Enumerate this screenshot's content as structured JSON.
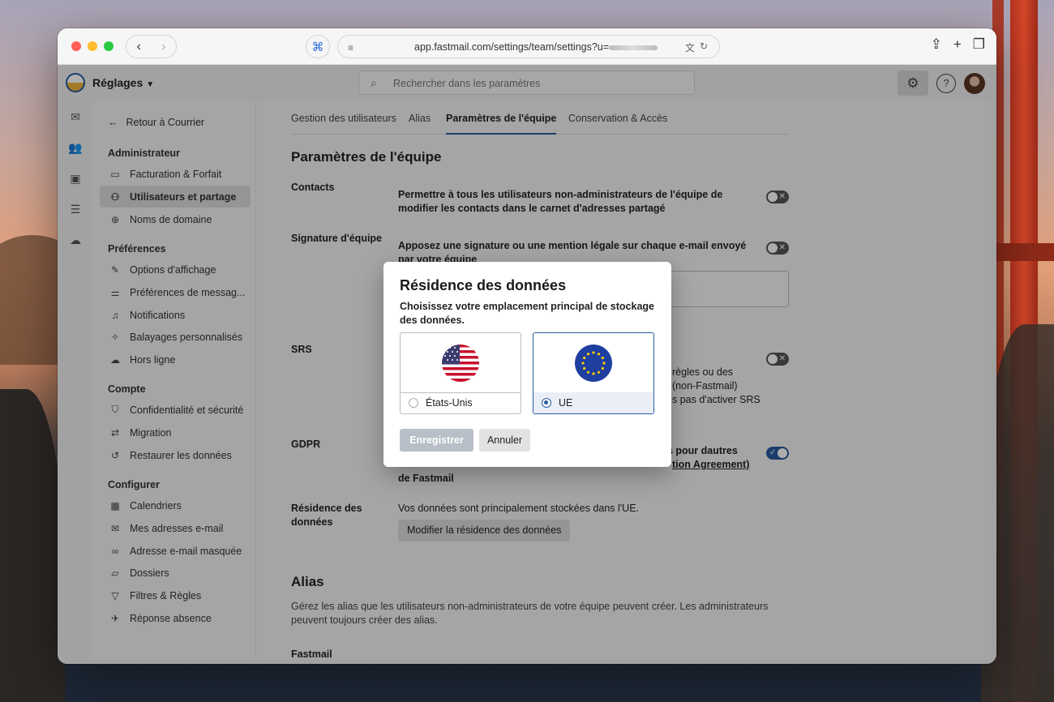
{
  "browser": {
    "url": "app.fastmail.com/settings/team/settings?u=",
    "nav_back": "‹",
    "nav_forward": "›"
  },
  "app": {
    "title": "Réglages",
    "search_placeholder": "Rechercher dans les paramètres"
  },
  "sidebar": {
    "back_label": "Retour à Courrier",
    "sections": {
      "admin": "Administrateur",
      "prefs": "Préférences",
      "account": "Compte",
      "configure": "Configurer"
    },
    "items": [
      {
        "label": "Facturation & Forfait",
        "icon": "card-icon"
      },
      {
        "label": "Utilisateurs et partage",
        "icon": "users-icon"
      },
      {
        "label": "Noms de domaine",
        "icon": "globe-icon"
      },
      {
        "label": "Options d'affichage",
        "icon": "brush-icon"
      },
      {
        "label": "Préférences de messag...",
        "icon": "sliders-icon"
      },
      {
        "label": "Notifications",
        "icon": "bell-icon"
      },
      {
        "label": "Balayages personnalisés",
        "icon": "sweep-icon"
      },
      {
        "label": "Hors ligne",
        "icon": "cloud-off-icon"
      },
      {
        "label": "Confidentialité et sécurité",
        "icon": "shield-icon"
      },
      {
        "label": "Migration",
        "icon": "migration-icon"
      },
      {
        "label": "Restaurer les données",
        "icon": "restore-icon"
      },
      {
        "label": "Calendriers",
        "icon": "calendar-icon"
      },
      {
        "label": "Mes adresses e-mail",
        "icon": "mail-icon"
      },
      {
        "label": "Adresse e-mail masquée",
        "icon": "mask-icon"
      },
      {
        "label": "Dossiers",
        "icon": "folder-icon"
      },
      {
        "label": "Filtres & Règles",
        "icon": "filter-icon"
      },
      {
        "label": "Réponse absence",
        "icon": "plane-icon"
      }
    ]
  },
  "tabs": [
    "Gestion des utilisateurs",
    "Alias",
    "Paramètres de l'équipe",
    "Conservation & Accès"
  ],
  "main": {
    "heading": "Paramètres de l'équipe",
    "contacts_label": "Contacts",
    "contacts_desc": "Permettre à tous les utilisateurs non-administrateurs de l'équipe de modifier les contacts dans le carnet d'adresses partagé",
    "signature_label": "Signature d'équipe",
    "signature_desc": "Apposez une signature ou une mention légale sur chaque e-mail envoyé par votre équipe",
    "srs_label": "SRS",
    "srs_line1": "règles ou des",
    "srs_line2": "(non-Fastmail)",
    "srs_line3": "s pas d'activer SRS",
    "gdpr_label": "GDPR",
    "gdpr_line1": "es pour dautres",
    "gdpr_line2": "tion Agreement)",
    "gdpr_line3": "de Fastmail",
    "residence_label": "Résidence des données",
    "residence_desc": "Vos données sont principalement stockées dans l'UE.",
    "residence_button": "Modifier la résidence des données",
    "alias_heading": "Alias",
    "alias_desc": "Gérez les alias que les utilisateurs non-administrateurs de votre équipe peuvent créer. Les administrateurs peuvent toujours créer des alias.",
    "fastmail_label": "Fastmail"
  },
  "modal": {
    "title": "Résidence des données",
    "subtitle": "Choisissez votre emplacement principal de stockage des données.",
    "option_us": "États-Unis",
    "option_eu": "UE",
    "selected": "UE",
    "save": "Enregistrer",
    "cancel": "Annuler"
  },
  "colors": {
    "accent": "#2a5aa0",
    "disabled_button": "#b8bfc9"
  }
}
